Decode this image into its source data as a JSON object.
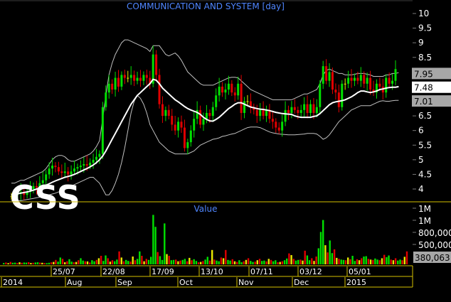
{
  "chart_data": [
    {
      "type": "candlestick",
      "title": "COMMUNICATION AND SYSTEM [day]",
      "watermark": "CSS",
      "ylim": [
        3.5,
        10.2
      ],
      "yticks": [
        "10",
        "9.5",
        "9",
        "8.5",
        "8",
        "7.5",
        "7",
        "6.5",
        "6",
        "5.5",
        "5",
        "4.5",
        "4"
      ],
      "price_tags": [
        {
          "label": "7.95",
          "value": 7.95,
          "fill": "#a7a7a7",
          "text_color": "#000000"
        },
        {
          "label": "7.48",
          "value": 7.48,
          "fill": "#ffffff",
          "text_color": "#000000"
        },
        {
          "label": "7.01",
          "value": 7.01,
          "fill": "#a7a7a7",
          "text_color": "#000000"
        }
      ],
      "series": [
        {
          "name": "close",
          "values": [
            3.75,
            3.8,
            3.85,
            3.9,
            3.8,
            3.9,
            4,
            4.1,
            4.05,
            4.2,
            4.3,
            4.5,
            4.7,
            4.8,
            4.75,
            4.6,
            4.55,
            4.6,
            4.5,
            4.6,
            4.7,
            4.75,
            4.8,
            4.85,
            4.8,
            4.9,
            5,
            5.1,
            5.2,
            6.8,
            7.3,
            7.6,
            7.4,
            7.8,
            7.5,
            7.9,
            7.8,
            7.8,
            7.9,
            7.7,
            7.8,
            7.7,
            7.9,
            7.8,
            7.6,
            8.6,
            7.9,
            6.9,
            6.5,
            6.7,
            6.5,
            6.2,
            6,
            6.3,
            6.1,
            5.4,
            5.6,
            6,
            6.4,
            6.7,
            6.2,
            6.4,
            6.6,
            6.5,
            6.8,
            7.2,
            7.5,
            7.3,
            7.4,
            7.6,
            7.3,
            7.2,
            7.6,
            6.6,
            7,
            7,
            6.8,
            6.7,
            6.5,
            6.7,
            6.5,
            6.7,
            6.4,
            6.3,
            6.1,
            6,
            6.3,
            6.7,
            6.6,
            6.8,
            6.7,
            6.6,
            6.7,
            6.9,
            6.6,
            6.9,
            6.6,
            6.8,
            7.6,
            8.2,
            7.7,
            8,
            7.4,
            7.3,
            6.8,
            7.6,
            7.6,
            7.8,
            7.7,
            7.8,
            7.7,
            7.9,
            7.6,
            7.8,
            7.4,
            7.3,
            7.6,
            7.5,
            7.3,
            7.8,
            7.6,
            7.7,
            8.1
          ]
        },
        {
          "name": "ma",
          "values": [
            3.8,
            3.82,
            3.84,
            3.86,
            3.88,
            3.9,
            3.93,
            3.96,
            4,
            4.04,
            4.08,
            4.13,
            4.18,
            4.23,
            4.28,
            4.32,
            4.36,
            4.4,
            4.43,
            4.46,
            4.5,
            4.55,
            4.6,
            4.65,
            4.7,
            4.76,
            4.82,
            4.9,
            5,
            5.13,
            5.3,
            5.5,
            5.7,
            5.9,
            6.1,
            6.3,
            6.5,
            6.7,
            6.9,
            7.05,
            7.2,
            7.3,
            7.4,
            7.5,
            7.6,
            7.75,
            7.72,
            7.6,
            7.45,
            7.35,
            7.25,
            7.15,
            7.05,
            6.98,
            6.9,
            6.82,
            6.75,
            6.7,
            6.66,
            6.62,
            6.55,
            6.45,
            6.38,
            6.33,
            6.32,
            6.38,
            6.45,
            6.55,
            6.65,
            6.75,
            6.82,
            6.9,
            6.95,
            6.95,
            6.9,
            6.85,
            6.8,
            6.78,
            6.75,
            6.73,
            6.72,
            6.7,
            6.68,
            6.65,
            6.62,
            6.6,
            6.58,
            6.57,
            6.56,
            6.55,
            6.5,
            6.47,
            6.45,
            6.45,
            6.45,
            6.45,
            6.48,
            6.5,
            6.58,
            6.68,
            6.78,
            6.88,
            6.95,
            6.98,
            7,
            7.02,
            7.05,
            7.1,
            7.15,
            7.22,
            7.3,
            7.35,
            7.35,
            7.32,
            7.3,
            7.32,
            7.35,
            7.4,
            7.42,
            7.45,
            7.47,
            7.48,
            7.48,
            7.5
          ]
        },
        {
          "name": "upper_band",
          "values": [
            4.2,
            4.2,
            4.25,
            4.3,
            4.3,
            4.35,
            4.4,
            4.45,
            4.5,
            4.55,
            4.6,
            4.7,
            4.85,
            5,
            5.1,
            5.15,
            5.15,
            5.1,
            5,
            4.95,
            4.95,
            5,
            5.05,
            5.1,
            5.15,
            5.2,
            5.3,
            5.45,
            5.65,
            6.4,
            7.2,
            7.9,
            8.3,
            8.6,
            8.8,
            9,
            9.1,
            9.1,
            9.05,
            9,
            8.95,
            8.9,
            8.85,
            8.8,
            8.7,
            8.9,
            8.9,
            8.9,
            8.75,
            8.6,
            8.55,
            8.6,
            8.65,
            8.55,
            8.4,
            8.2,
            8,
            7.9,
            7.8,
            7.7,
            7.6,
            7.55,
            7.55,
            7.55,
            7.55,
            7.6,
            7.65,
            7.7,
            7.75,
            7.8,
            7.82,
            7.82,
            7.8,
            7.7,
            7.6,
            7.5,
            7.4,
            7.35,
            7.3,
            7.25,
            7.2,
            7.15,
            7.1,
            7.05,
            7.05,
            7.05,
            7.05,
            7.05,
            7.05,
            7.05,
            7.1,
            7.15,
            7.2,
            7.25,
            7.25,
            7.3,
            7.35,
            7.4,
            7.6,
            7.9,
            8.05,
            8.1,
            8.05,
            8,
            7.95,
            7.95,
            7.9,
            7.9,
            7.9,
            7.92,
            7.95,
            7.95,
            7.95,
            7.92,
            7.9,
            7.85,
            7.85,
            7.85,
            7.85,
            7.9,
            7.9,
            7.95,
            7.95,
            7.98
          ]
        },
        {
          "name": "lower_band",
          "values": [
            3.6,
            3.6,
            3.6,
            3.6,
            3.62,
            3.64,
            3.66,
            3.68,
            3.7,
            3.72,
            3.75,
            3.78,
            3.8,
            3.83,
            3.86,
            3.9,
            3.95,
            4,
            4.05,
            4.1,
            4.15,
            4.2,
            4.25,
            4.3,
            4.35,
            4.4,
            4.4,
            4.3,
            4.2,
            4,
            3.8,
            3.8,
            3.95,
            4.2,
            4.5,
            4.9,
            5.4,
            6,
            6.6,
            7,
            7.2,
            7.1,
            6.9,
            6.6,
            6.2,
            6,
            5.8,
            5.6,
            5.5,
            5.4,
            5.3,
            5.25,
            5.2,
            5.2,
            5.2,
            5.2,
            5.2,
            5.25,
            5.3,
            5.4,
            5.5,
            5.55,
            5.6,
            5.65,
            5.7,
            5.72,
            5.75,
            5.8,
            5.82,
            5.85,
            5.88,
            5.9,
            5.95,
            6,
            6.05,
            6.1,
            6.12,
            6.12,
            6.12,
            6.1,
            6.05,
            6,
            5.95,
            5.92,
            5.9,
            5.88,
            5.87,
            5.86,
            5.85,
            5.85,
            5.85,
            5.86,
            5.87,
            5.88,
            5.9,
            5.9,
            5.9,
            5.88,
            5.8,
            5.7,
            5.75,
            5.85,
            6,
            6.15,
            6.3,
            6.4,
            6.5,
            6.6,
            6.7,
            6.75,
            6.8,
            6.85,
            6.85,
            6.85,
            6.85,
            6.9,
            6.95,
            7,
            7.02,
            7,
            7,
            7.02,
            7.03,
            7.03
          ]
        }
      ]
    },
    {
      "type": "bar",
      "title": "Value",
      "yticks": [
        "1M",
        "1M",
        "800,000",
        "500,000"
      ],
      "last_value_label": "380,063",
      "values": [
        40000,
        55000,
        35000,
        70000,
        45000,
        50000,
        40000,
        60000,
        45000,
        55000,
        50000,
        65000,
        40000,
        45000,
        55000,
        60000,
        50000,
        45000,
        40000,
        35000,
        45000,
        60000,
        70000,
        130000,
        80000,
        200000,
        160000,
        60000,
        90000,
        150000,
        80000,
        60000,
        70000,
        120000,
        180000,
        110000,
        90000,
        85000,
        55000,
        120000,
        90000,
        130000,
        180000,
        250000,
        100000,
        260000,
        180000,
        80000,
        120000,
        90000,
        140000,
        380000,
        200000,
        90000,
        130000,
        100000,
        80000,
        230000,
        120000,
        160000,
        380000,
        250000,
        90000,
        160000,
        130000,
        220000,
        1450000,
        1100000,
        360000,
        240000,
        130000,
        1200000,
        300000,
        250000,
        120000,
        130000,
        140000,
        90000,
        110000,
        130000,
        160000,
        90000,
        190000,
        120000,
        150000,
        100000,
        60000,
        70000,
        95000,
        140000,
        220000,
        110000,
        420000,
        140000,
        110000,
        90000,
        200000,
        180000,
        420000,
        130000,
        110000,
        150000,
        90000,
        70000,
        120000,
        60000,
        90000,
        130000,
        180000,
        100000,
        70000,
        80000,
        120000,
        160000,
        100000,
        110000,
        85000,
        160000,
        130000,
        90000,
        120000,
        60000,
        70000,
        90000,
        120000,
        170000,
        320000,
        270000,
        160000,
        110000,
        130000,
        140000,
        110000,
        400000,
        260000,
        120000,
        180000,
        100000,
        230000,
        470000,
        950000,
        1300000,
        560000,
        350000,
        700000,
        330000,
        440000,
        190000,
        160000,
        140000,
        130000,
        120000,
        200000,
        150000,
        250000,
        100000,
        150000,
        120000,
        180000,
        230000,
        240000,
        160000,
        140000,
        130000,
        170000,
        140000,
        120000,
        180000,
        280000,
        210000,
        260000,
        140000,
        120000,
        180000,
        110000,
        140000,
        120000,
        220000,
        380063
      ]
    }
  ],
  "x_axis": {
    "row1_labels": [
      "25/07",
      "22/08",
      "17/09",
      "13/10",
      "07/11",
      "03/12",
      "05/01"
    ],
    "row2_labels": [
      "2014",
      "Aug",
      "Sep",
      "Oct",
      "Nov",
      "Dec",
      "2015"
    ]
  },
  "colors": {
    "background": "#000000",
    "up": "#00e000",
    "down": "#e00000",
    "neutral": "#e8e800",
    "ma": "#ffffff",
    "band": "#c0c0c0",
    "title": "#4f86ff",
    "text": "#ffffff",
    "divider": "#d4c000"
  }
}
